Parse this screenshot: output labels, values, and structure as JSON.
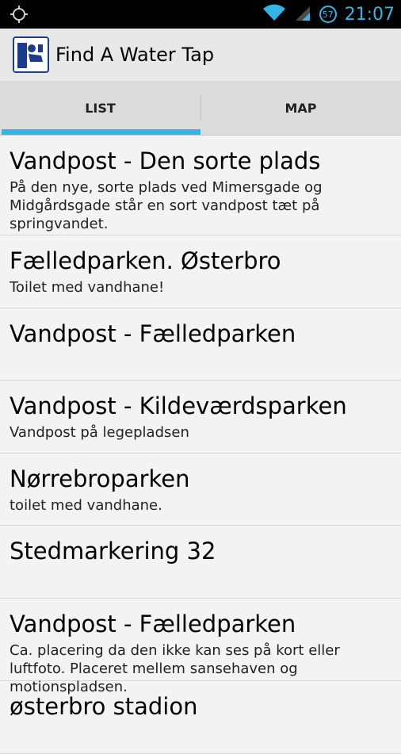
{
  "status_bar": {
    "time": "21:07",
    "battery": "57",
    "icons": [
      "location-target-icon",
      "wifi-icon",
      "signal-icon",
      "battery-icon"
    ]
  },
  "action_bar": {
    "title": "Find A Water Tap",
    "app_icon": "water-tap-app-icon"
  },
  "tabs": [
    {
      "label": "LIST",
      "selected": true
    },
    {
      "label": "MAP",
      "selected": false
    }
  ],
  "colors": {
    "accent": "#33b5e5",
    "app_icon_border": "#1a3b8e"
  },
  "list": {
    "items": [
      {
        "title": "Vandpost - Den sorte plads",
        "description": "På den nye, sorte plads ved Mimersgade og Midgårdsgade står en sort vandpost tæt på springvandet."
      },
      {
        "title": "Fælledparken. Østerbro",
        "description": "Toilet med vandhane!"
      },
      {
        "title": "Vandpost - Fælledparken",
        "description": ""
      },
      {
        "title": "Vandpost - Kildeværdsparken",
        "description": "Vandpost på legepladsen"
      },
      {
        "title": "Nørrebroparken",
        "description": "toilet med vandhane."
      },
      {
        "title": "Stedmarkering 32",
        "description": ""
      },
      {
        "title": "Vandpost - Fælledparken",
        "description": "Ca. placering da den ikke kan ses på kort eller luftfoto. Placeret mellem sansehaven og motionspladsen."
      },
      {
        "title": "østerbro stadion",
        "description": ""
      }
    ]
  }
}
